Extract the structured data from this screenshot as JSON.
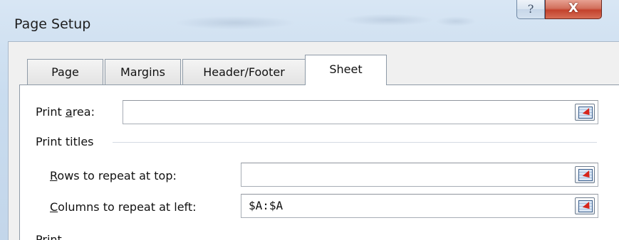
{
  "window": {
    "title": "Page Setup",
    "help_label": "?",
    "close_label": "X"
  },
  "tabs": [
    {
      "label": "Page",
      "active": false
    },
    {
      "label": "Margins",
      "active": false
    },
    {
      "label": "Header/Footer",
      "active": false
    },
    {
      "label": "Sheet",
      "active": true
    }
  ],
  "sheet": {
    "print_area": {
      "label_pre": "Print ",
      "label_accel": "a",
      "label_post": "rea:",
      "value": ""
    },
    "print_titles_label": "Print titles",
    "rows_repeat": {
      "label_accel": "R",
      "label_post": "ows to repeat at top:",
      "value": ""
    },
    "cols_repeat": {
      "label_accel": "C",
      "label_post": "olumns to repeat at left:",
      "value": "$A:$A"
    },
    "print_section_label": "Print"
  },
  "icons": {
    "collapse": "collapse-dialog-icon"
  }
}
